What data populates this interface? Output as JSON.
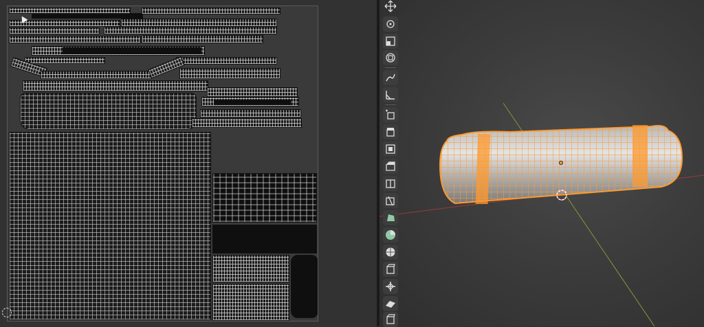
{
  "uv_editor": {
    "island_groups": [
      "bag-strap-islands",
      "bag-top-islands",
      "bag-side-islands",
      "bag-body-island-large",
      "buckle-islands"
    ]
  },
  "toolbar": {
    "tools": [
      {
        "name": "move-view-icon"
      },
      {
        "name": "cursor-icon"
      },
      {
        "name": "scale-icon"
      },
      {
        "name": "transform-icon"
      },
      {
        "name": "annotate-icon"
      },
      {
        "name": "measure-icon"
      },
      {
        "name": "add-cube-icon"
      },
      {
        "name": "extrude-region-icon"
      },
      {
        "name": "inset-faces-icon"
      },
      {
        "name": "bevel-icon"
      },
      {
        "name": "loop-cut-icon"
      },
      {
        "name": "knife-icon"
      },
      {
        "name": "poly-build-icon"
      },
      {
        "name": "spin-icon"
      },
      {
        "name": "smooth-icon"
      },
      {
        "name": "edge-slide-icon"
      },
      {
        "name": "shrink-fatten-icon"
      },
      {
        "name": "shear-icon"
      },
      {
        "name": "rip-region-icon"
      }
    ]
  },
  "viewport": {
    "colors": {
      "selection": "#ff9a2e",
      "mesh_surface": "#c9c9c9",
      "x_axis": "#9a3b3b",
      "y_axis": "#7f9a3b"
    }
  }
}
